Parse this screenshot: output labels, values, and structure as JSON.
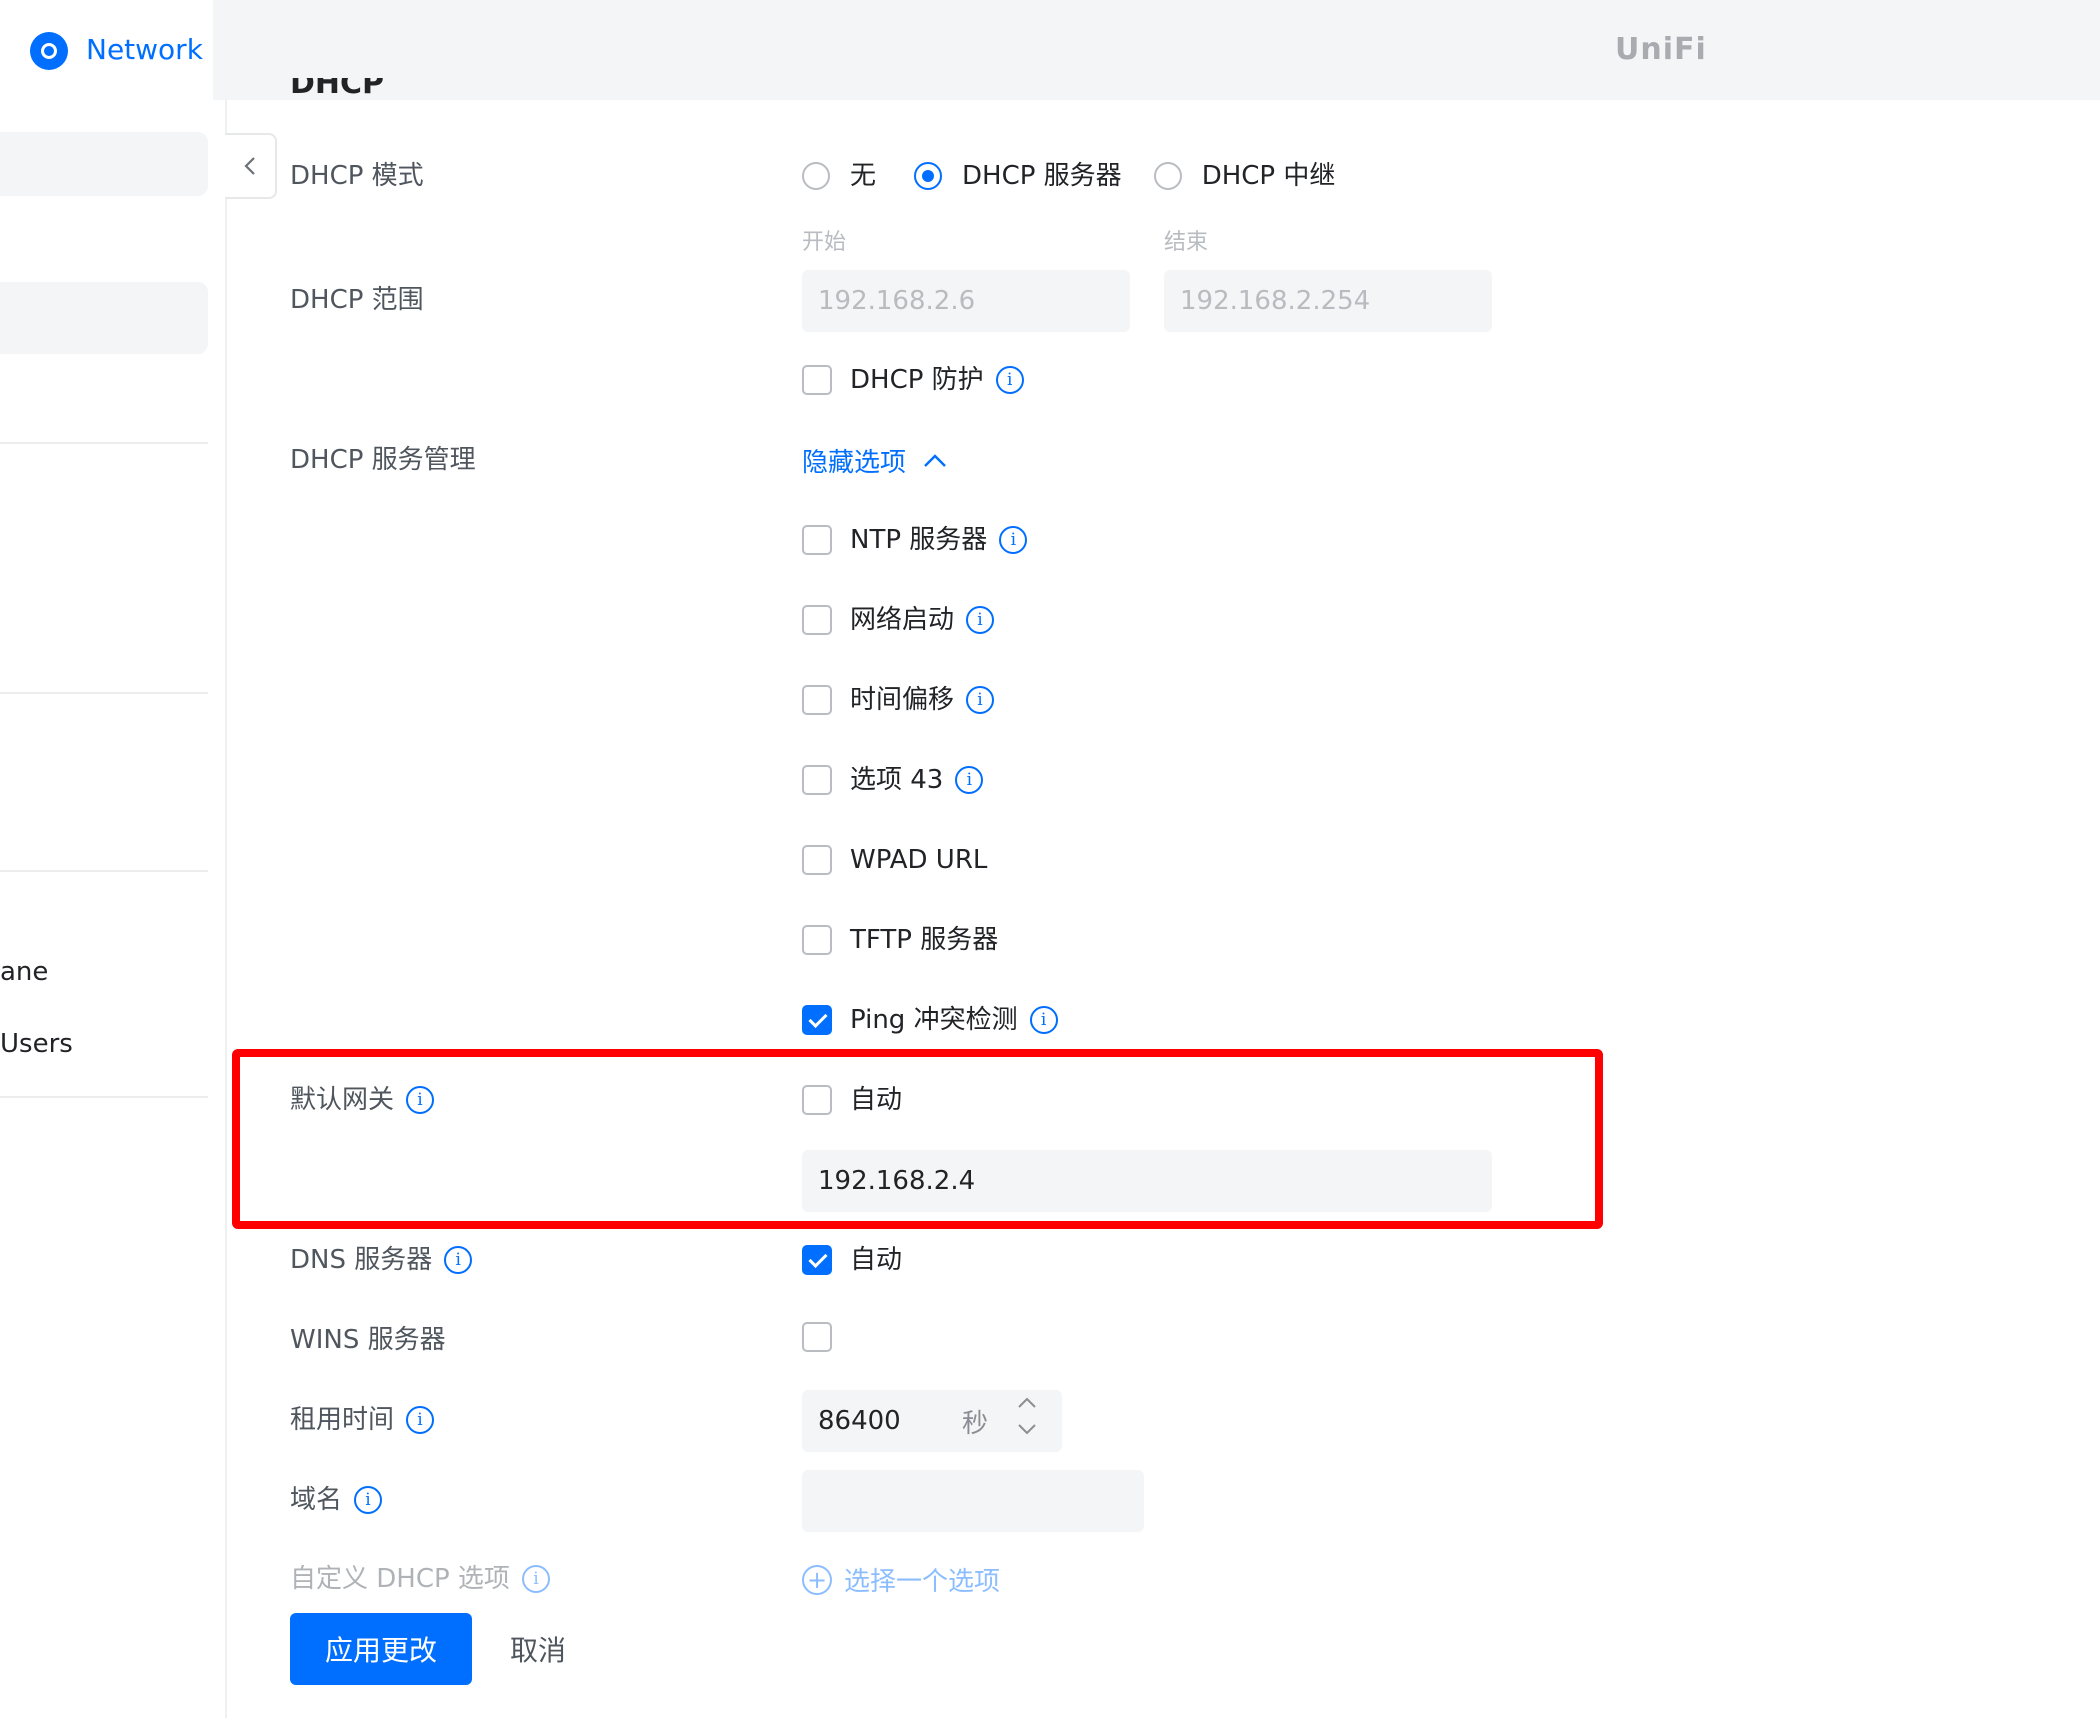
{
  "header": {
    "app_name": "Network",
    "brand_logo_text": "UniFi",
    "brand_color": "#006fff"
  },
  "sidebar": {
    "items": [
      {
        "label": "ane"
      },
      {
        "label": "Users"
      }
    ]
  },
  "form": {
    "section_title": "DHCP",
    "dhcp_mode": {
      "label": "DHCP 模式",
      "options": [
        "无",
        "DHCP 服务器",
        "DHCP 中继"
      ],
      "selected": "DHCP 服务器"
    },
    "dhcp_range": {
      "label": "DHCP 范围",
      "start_label": "开始",
      "start_value": "192.168.2.6",
      "end_label": "结束",
      "end_value": "192.168.2.254"
    },
    "dhcp_guard": {
      "label": "DHCP 防护",
      "checked": false
    },
    "dhcp_service_mgmt": {
      "label": "DHCP 服务管理",
      "toggle_label": "隐藏选项",
      "options": [
        {
          "label": "NTP 服务器",
          "checked": false,
          "info": true
        },
        {
          "label": "网络启动",
          "checked": false,
          "info": true
        },
        {
          "label": "时间偏移",
          "checked": false,
          "info": true
        },
        {
          "label": "选项 43",
          "checked": false,
          "info": true
        },
        {
          "label": "WPAD URL",
          "checked": false,
          "info": false
        },
        {
          "label": "TFTP 服务器",
          "checked": false,
          "info": false
        },
        {
          "label": "Ping 冲突检测",
          "checked": true,
          "info": true
        }
      ]
    },
    "default_gateway": {
      "label": "默认网关",
      "auto_label": "自动",
      "auto_checked": false,
      "value": "192.168.2.4"
    },
    "dns_server": {
      "label": "DNS 服务器",
      "auto_label": "自动",
      "auto_checked": true
    },
    "wins_server": {
      "label": "WINS 服务器",
      "checked": false
    },
    "lease_time": {
      "label": "租用时间",
      "value": "86400",
      "unit": "秒"
    },
    "domain_name": {
      "label": "域名",
      "value": ""
    },
    "custom_dhcp": {
      "label": "自定义 DHCP 选项",
      "add_label": "选择一个选项"
    },
    "actions": {
      "apply_label": "应用更改",
      "cancel_label": "取消"
    }
  }
}
